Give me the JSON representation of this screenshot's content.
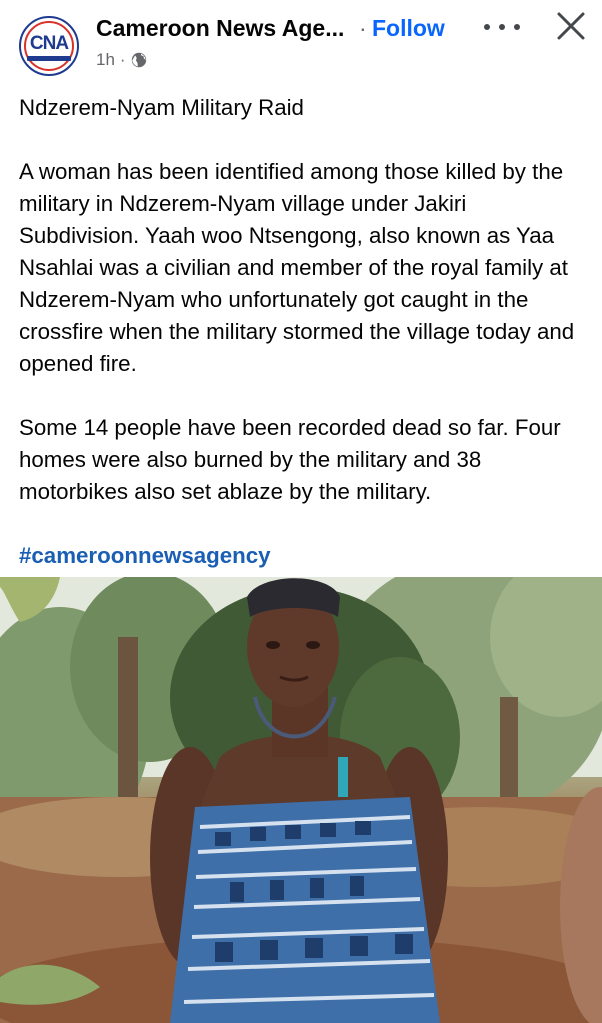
{
  "header": {
    "page_name": "Cameroon News Age...",
    "separator": "·",
    "follow_label": "Follow",
    "time": "1h",
    "time_sep": "·",
    "avatar_text": "CNA"
  },
  "post": {
    "paragraphs": [
      "Ndzerem-Nyam Military Raid",
      "A woman has been identified among those killed by the military in Ndzerem-Nyam village under Jakiri Subdivision. Yaah woo Ntsengong, also known as Yaa Nsahlai was a civilian and member of the royal family at Ndzerem-Nyam who unfortunately got caught in the crossfire when the military stormed the village today and opened fire.",
      "Some 14 people have been recorded dead so far. Four homes were also burned by the military and 38 motorbikes also set ablaze by the military."
    ],
    "hashtag": "#cameroonnewsagency"
  },
  "colors": {
    "follow": "#0866ff",
    "hashtag": "#1a5fb4",
    "text": "#050505",
    "secondary": "#65676b"
  },
  "icons": {
    "audience": "globe-icon",
    "more": "more-options-icon",
    "close": "close-icon"
  }
}
